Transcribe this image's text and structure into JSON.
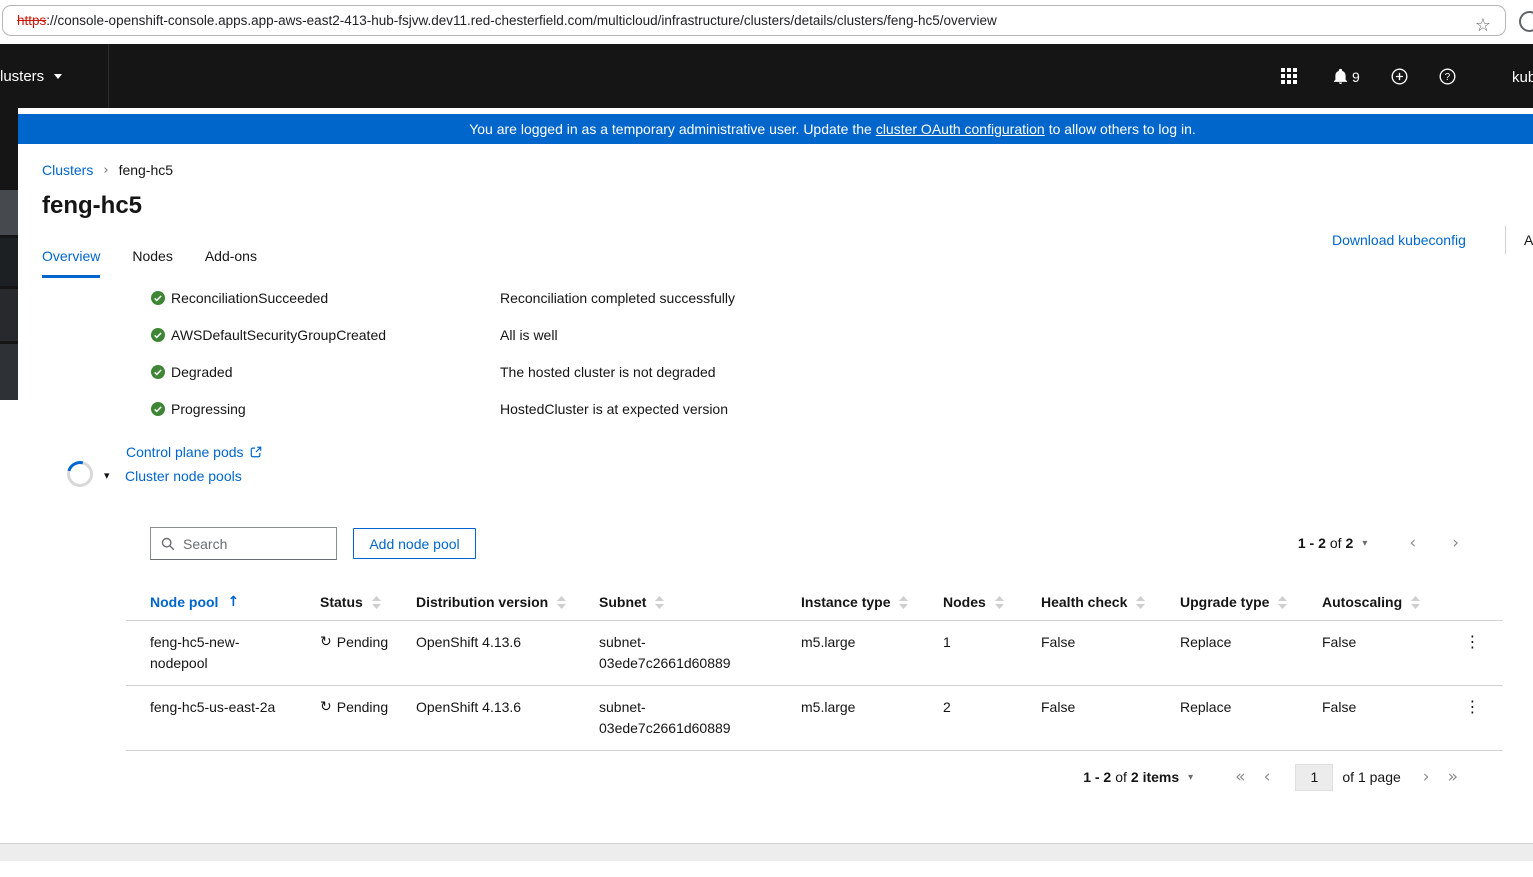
{
  "colors": {
    "brand_blue": "#0066cc",
    "success_green": "#3e8635",
    "masthead_bg": "#151515",
    "banner_bg": "#0066cc",
    "insecure_red": "#c9190b"
  },
  "browser": {
    "url_scheme": "https",
    "url_rest": "://console-openshift-console.apps.app-aws-east2-413-hub-fsjvw.dev11.red-chesterfield.com/multicloud/infrastructure/clusters/details/clusters/feng-hc5/overview"
  },
  "masthead": {
    "cluster_selector_label": "lusters",
    "notification_count": "9",
    "username_partial": "kub"
  },
  "banner": {
    "text_before": "You are logged in as a temporary administrative user. Update the",
    "link_text": "cluster OAuth configuration",
    "text_after": "to allow others to log in."
  },
  "breadcrumb": {
    "items": [
      {
        "label": "Clusters"
      },
      {
        "label": "feng-hc5"
      }
    ]
  },
  "page": {
    "title": "feng-hc5",
    "download_kubeconfig_label": "Download kubeconfig",
    "actions_partial_label": "A"
  },
  "tabs": [
    {
      "label": "Overview"
    },
    {
      "label": "Nodes"
    },
    {
      "label": "Add-ons"
    }
  ],
  "conditions": [
    {
      "name": "ReconciliationSucceeded",
      "message": "Reconciliation completed successfully"
    },
    {
      "name": "AWSDefaultSecurityGroupCreated",
      "message": "All is well"
    },
    {
      "name": "Degraded",
      "message": "The hosted cluster is not degraded"
    },
    {
      "name": "Progressing",
      "message": "HostedCluster is at expected version"
    }
  ],
  "links": {
    "control_plane_pods": "Control plane pods",
    "cluster_node_pools": "Cluster node pools"
  },
  "toolbar": {
    "search_placeholder": "Search",
    "add_node_pool_label": "Add node pool",
    "pagination": {
      "range": "1 - 2",
      "of_word": "of",
      "total": "2"
    }
  },
  "table": {
    "columns": [
      "Node pool",
      "Status",
      "Distribution version",
      "Subnet",
      "Instance type",
      "Nodes",
      "Health check",
      "Upgrade type",
      "Autoscaling"
    ],
    "sorted_column": "Node pool",
    "rows": [
      {
        "node_pool": "feng-hc5-new-nodepool",
        "status": "Pending",
        "distribution_version": "OpenShift 4.13.6",
        "subnet": "subnet-03ede7c2661d60889",
        "instance_type": "m5.large",
        "nodes": "1",
        "health_check": "False",
        "upgrade_type": "Replace",
        "autoscaling": "False"
      },
      {
        "node_pool": "feng-hc5-us-east-2a",
        "status": "Pending",
        "distribution_version": "OpenShift 4.13.6",
        "subnet": "subnet-03ede7c2661d60889",
        "instance_type": "m5.large",
        "nodes": "2",
        "health_check": "False",
        "upgrade_type": "Replace",
        "autoscaling": "False"
      }
    ]
  },
  "pagination_bottom": {
    "range": "1 - 2",
    "of_word": "of",
    "total": "2 items",
    "page_value": "1",
    "page_label": "of 1 page"
  }
}
